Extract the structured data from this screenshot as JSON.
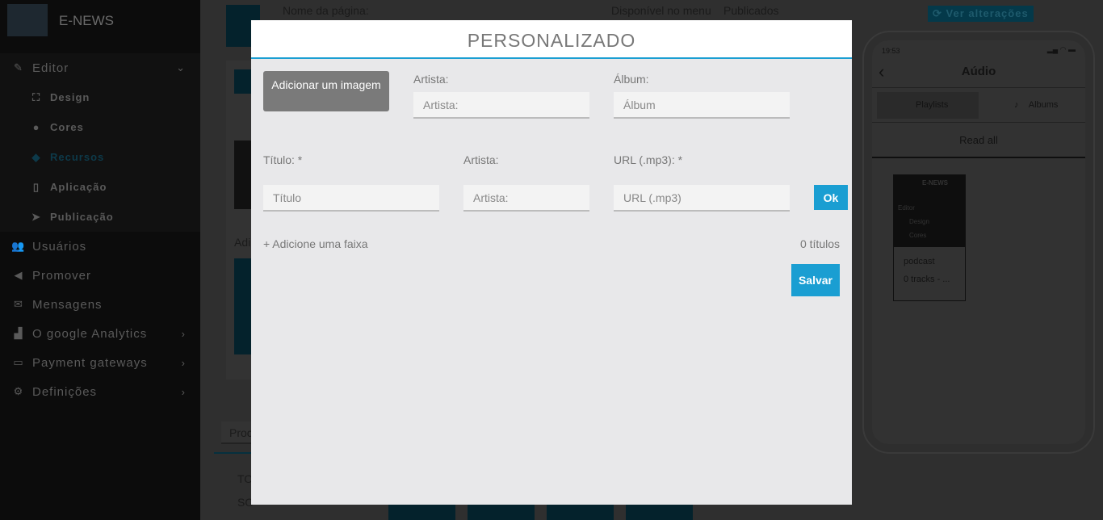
{
  "sidebar": {
    "brand": "E-NEWS",
    "items": [
      {
        "label": "Editor",
        "icon": "pencil-icon"
      },
      {
        "label": "Design",
        "icon": "design-icon"
      },
      {
        "label": "Cores",
        "icon": "palette-icon"
      },
      {
        "label": "Recursos",
        "icon": "cube-icon"
      },
      {
        "label": "Aplicação",
        "icon": "mobile-icon"
      },
      {
        "label": "Publicação",
        "icon": "paper-plane-icon"
      },
      {
        "label": "Usuários",
        "icon": "users-icon"
      },
      {
        "label": "Promover",
        "icon": "megaphone-icon"
      },
      {
        "label": "Mensagens",
        "icon": "envelope-icon"
      },
      {
        "label": "O google Analytics",
        "icon": "chart-icon"
      },
      {
        "label": "Payment gateways",
        "icon": "credit-card-icon"
      },
      {
        "label": "Definições",
        "icon": "gears-icon"
      }
    ]
  },
  "background": {
    "page_name_label": "Nome da página:",
    "menu_label": "Disponível no menu",
    "published_label": "Publicados",
    "add_label": "Adi",
    "proc": "Proc",
    "to": "TO",
    "so": "SO",
    "view_changes": "Ver alterações"
  },
  "phone": {
    "time": "19:53",
    "title": "Aúdio",
    "tabs": [
      "Playlists",
      "Albums"
    ],
    "read_all": "Read all",
    "card_brand": "E-NEWS",
    "card_items": [
      "Editor",
      "Design",
      "Cores"
    ],
    "card_title": "podcast",
    "card_sub": "0 tracks - ..."
  },
  "modal": {
    "title": "PERSONALIZADO",
    "add_image": "Adicionar um imagem",
    "artist_label": "Artista:",
    "artist_placeholder": "Artista:",
    "album_label": "Álbum:",
    "album_placeholder": "Álbum",
    "track_title_label": "Título: *",
    "track_title_placeholder": "Título",
    "track_artist_label": "Artista:",
    "track_artist_placeholder": "Artista:",
    "url_label": "URL (.mp3): *",
    "url_placeholder": "URL (.mp3)",
    "ok": "Ok",
    "add_track": "+ Adicione uma faixa",
    "count": "0 títulos",
    "save": "Salvar"
  },
  "colors": {
    "accent": "#1a9ed2"
  }
}
